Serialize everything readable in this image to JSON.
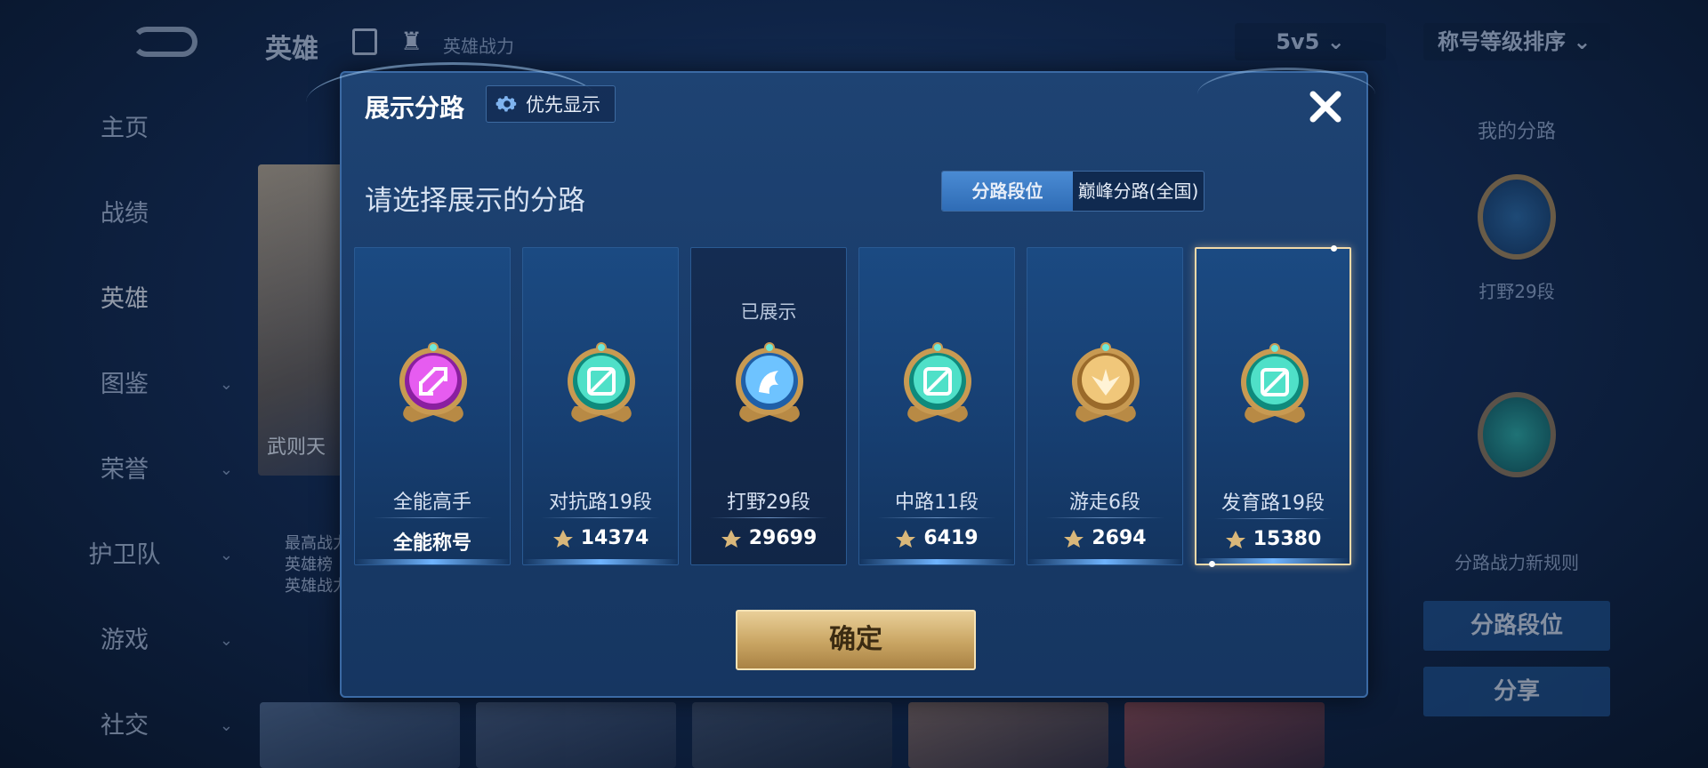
{
  "background": {
    "page_title": "英雄",
    "sub_label": "英雄战力",
    "mode_select": "5v5",
    "sort_select": "称号等级排序",
    "sidebar": [
      {
        "label": "主页",
        "chevron": false
      },
      {
        "label": "战绩",
        "chevron": false
      },
      {
        "label": "英雄",
        "chevron": false,
        "active": true
      },
      {
        "label": "图鉴",
        "chevron": true
      },
      {
        "label": "荣誉",
        "chevron": true
      },
      {
        "label": "护卫队",
        "chevron": true
      },
      {
        "label": "游戏",
        "chevron": true
      },
      {
        "label": "社交",
        "chevron": true
      }
    ],
    "hero_card_text": "武则天",
    "hero_desc": "最高战力\n英雄榜\n英雄战力",
    "right_panel": {
      "title": "我的分路",
      "badge_label": "打野29段",
      "rule_text": "分路战力新规则",
      "btn_lane_rank": "分路段位",
      "btn_share": "分享"
    }
  },
  "modal": {
    "title": "展示分路",
    "priority_button": "优先显示",
    "subtitle": "请选择展示的分路",
    "toggle": {
      "option1": "分路段位",
      "option2": "巅峰分路(全国)",
      "selected": "option1"
    },
    "cards": [
      {
        "name": "全能高手",
        "value": "全能称号",
        "shown": "",
        "emblem": "magenta",
        "selected": false,
        "dim": false
      },
      {
        "name": "对抗路19段",
        "value": "14374",
        "shown": "",
        "emblem": "teal",
        "selected": false,
        "dim": false
      },
      {
        "name": "打野29段",
        "value": "29699",
        "shown": "已展示",
        "emblem": "blue",
        "selected": false,
        "dim": true
      },
      {
        "name": "中路11段",
        "value": "6419",
        "shown": "",
        "emblem": "teal",
        "selected": false,
        "dim": false
      },
      {
        "name": "游走6段",
        "value": "2694",
        "shown": "",
        "emblem": "gold",
        "selected": false,
        "dim": false
      },
      {
        "name": "发育路19段",
        "value": "15380",
        "shown": "",
        "emblem": "teal",
        "selected": true,
        "dim": false
      }
    ],
    "confirm_label": "确定"
  },
  "colors": {
    "accent_blue": "#2f6cb5",
    "gold": "#c9a563",
    "selected_border": "#f2d9a8"
  }
}
